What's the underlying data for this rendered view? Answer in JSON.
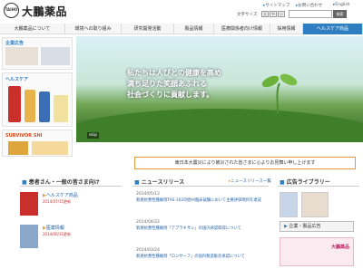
{
  "header": {
    "logo_mark": "TAIHO",
    "brand": "大鵬薬品",
    "util_links": [
      "サイトマップ",
      "お問い合わせ",
      "English"
    ],
    "font_size_label": "文字サイズ",
    "font_sizes": [
      "大",
      "中",
      "小"
    ],
    "search_button": "検索"
  },
  "nav": {
    "items": [
      "大鵬薬品について",
      "環境への取り組み",
      "研究開発活動",
      "製品情報",
      "医療関係者向け情報",
      "採用情報",
      "ヘルスケア商品"
    ]
  },
  "sidebar": {
    "kigyo_title": "企業広告",
    "healthcare_title": "ヘルスケア",
    "survivor": "SURVIVOR SHI"
  },
  "hero": {
    "lines": [
      "私たちは人びとの健康を高め",
      "満ち足りた笑顔あふれる",
      "社会づくりに貢献します。"
    ],
    "skip": "skip"
  },
  "notice": "東日本大震災により被災された皆さまに心よりお見舞い申し上げます",
  "patients": {
    "title": "患者さん・一般の皆さま向け",
    "items": [
      {
        "label": "ヘルスケア商品",
        "date": "2014/07/15更新"
      },
      {
        "label": "医薬情報",
        "date": "2014/06/11更新"
      }
    ]
  },
  "news": {
    "title": "ニュースリリース",
    "rss": "ニュースリリース一覧",
    "items": [
      {
        "date": "2014/05/12",
        "title": "新規抗悪性腫瘍剤TAS-102の欧州臨床試験において主要評価項目を達成"
      },
      {
        "date": "2014/04/22",
        "title": "新規抗悪性腫瘍剤「アブラキサン」の国内承認取得について"
      },
      {
        "date": "2014/03/24",
        "title": "新規抗悪性腫瘍剤「ロンサーフ」の国内製造販売承認について"
      }
    ]
  },
  "ads": {
    "title": "広告ライブラリー",
    "button": "企業・製品広告",
    "banner": "大鵬薬品"
  },
  "colors": {
    "accent": "#2e7fc2",
    "notice_border": "#e49a3c",
    "news_title": "#2060a8"
  }
}
